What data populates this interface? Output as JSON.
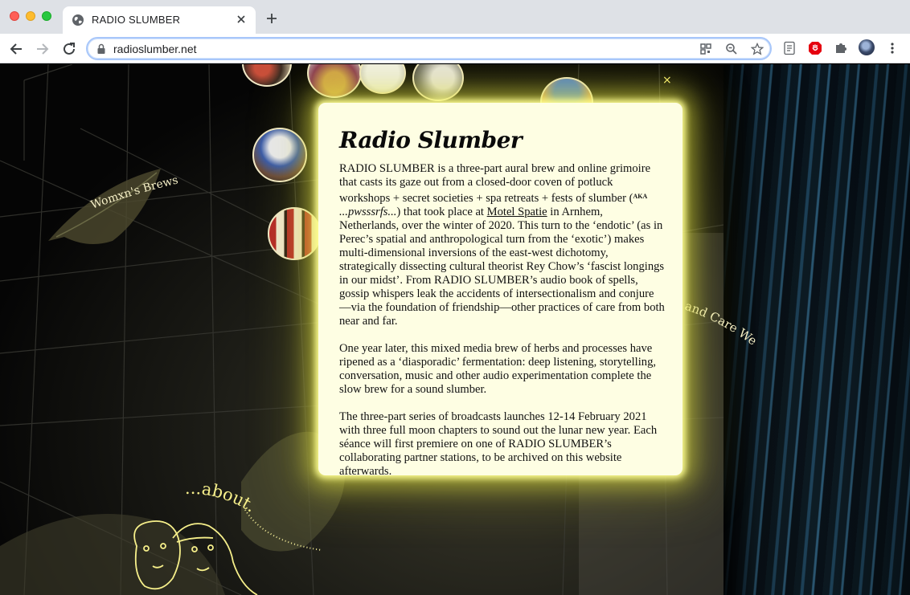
{
  "browser": {
    "tab_title": "RADIO SLUMBER",
    "url": "radioslumber.net"
  },
  "page": {
    "labels": {
      "womxns_brews": "Womxn's Brews",
      "and_care_we": "and Care We",
      "about": "...about......"
    },
    "modal": {
      "close": "×",
      "title": "Radio Slumber",
      "p1_a": "RADIO SLUMBER is a three-part aural brew and online grimoire that casts its gaze out from a closed-door coven of potluck workshops + secret societies + spa retreats + fests of slumber (",
      "p1_aka": "AKA",
      "p1_pwss": " ...pwsssrfs...",
      "p1_b": ") that took place at ",
      "p1_link": "Motel Spatie",
      "p1_c": " in Arnhem, Netherlands, over the winter of 2020. This turn to the ‘endotic’ (as in Perec’s spatial and anthropological turn from the ‘exotic’) makes multi-dimensional inversions of the east-west dichotomy, strategically dissecting cultural theorist Rey Chow’s ‘fascist longings in our midst’. From RADIO SLUMBER’s audio book of spells, gossip whispers leak the accidents of intersectionalism and conjure—via the foundation of friendship—other practices of care from both near and far.",
      "p2": "One year later, this mixed media brew of herbs and processes have ripened as a ‘diasporadic’ fermentation: deep listening, storytelling, conversation, music and other audio experimentation complete the slow brew for a sound slumber.",
      "p3": "The three-part series of broadcasts launches 12-14 February 2021 with three full moon chapters to sound out the lunar new year. Each séance will first premiere on one of RADIO SLUMBER’s collaborating partner stations, to be archived on this website afterwards."
    }
  }
}
